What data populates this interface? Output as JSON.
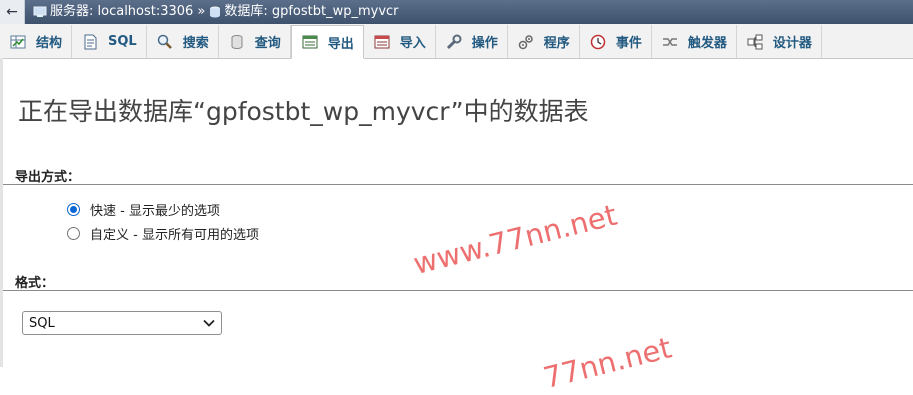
{
  "breadcrumb": {
    "back": "←",
    "server": "服务器: localhost:3306",
    "separator": "»",
    "database": "数据库: gpfostbt_wp_myvcr"
  },
  "tabs": [
    {
      "label": "结构",
      "icon": "structure-icon",
      "active": false
    },
    {
      "label": "SQL",
      "icon": "sql-icon",
      "active": false
    },
    {
      "label": "搜索",
      "icon": "search-icon",
      "active": false
    },
    {
      "label": "查询",
      "icon": "query-icon",
      "active": false
    },
    {
      "label": "导出",
      "icon": "export-icon",
      "active": true
    },
    {
      "label": "导入",
      "icon": "import-icon",
      "active": false
    },
    {
      "label": "操作",
      "icon": "wrench-icon",
      "active": false
    },
    {
      "label": "程序",
      "icon": "routines-icon",
      "active": false
    },
    {
      "label": "事件",
      "icon": "clock-icon",
      "active": false
    },
    {
      "label": "触发器",
      "icon": "trigger-icon",
      "active": false
    },
    {
      "label": "设计器",
      "icon": "designer-icon",
      "active": false
    }
  ],
  "page_title": "正在导出数据库“gpfostbt_wp_myvcr”中的数据表",
  "export_method": {
    "label": "导出方式：",
    "options": [
      {
        "label": "快速 - 显示最少的选项",
        "checked": true
      },
      {
        "label": "自定义 - 显示所有可用的选项",
        "checked": false
      }
    ]
  },
  "format": {
    "label": "格式：",
    "selected": "SQL",
    "dropdown_arrow": "⌄"
  },
  "watermark": {
    "text1": "www.77nn.net",
    "text2": "77nn.net",
    "color": "#e84646"
  },
  "colors": {
    "tab_text": "#235a81",
    "header_bg": "#4a5d79",
    "radio_accent": "#0a66d4"
  }
}
